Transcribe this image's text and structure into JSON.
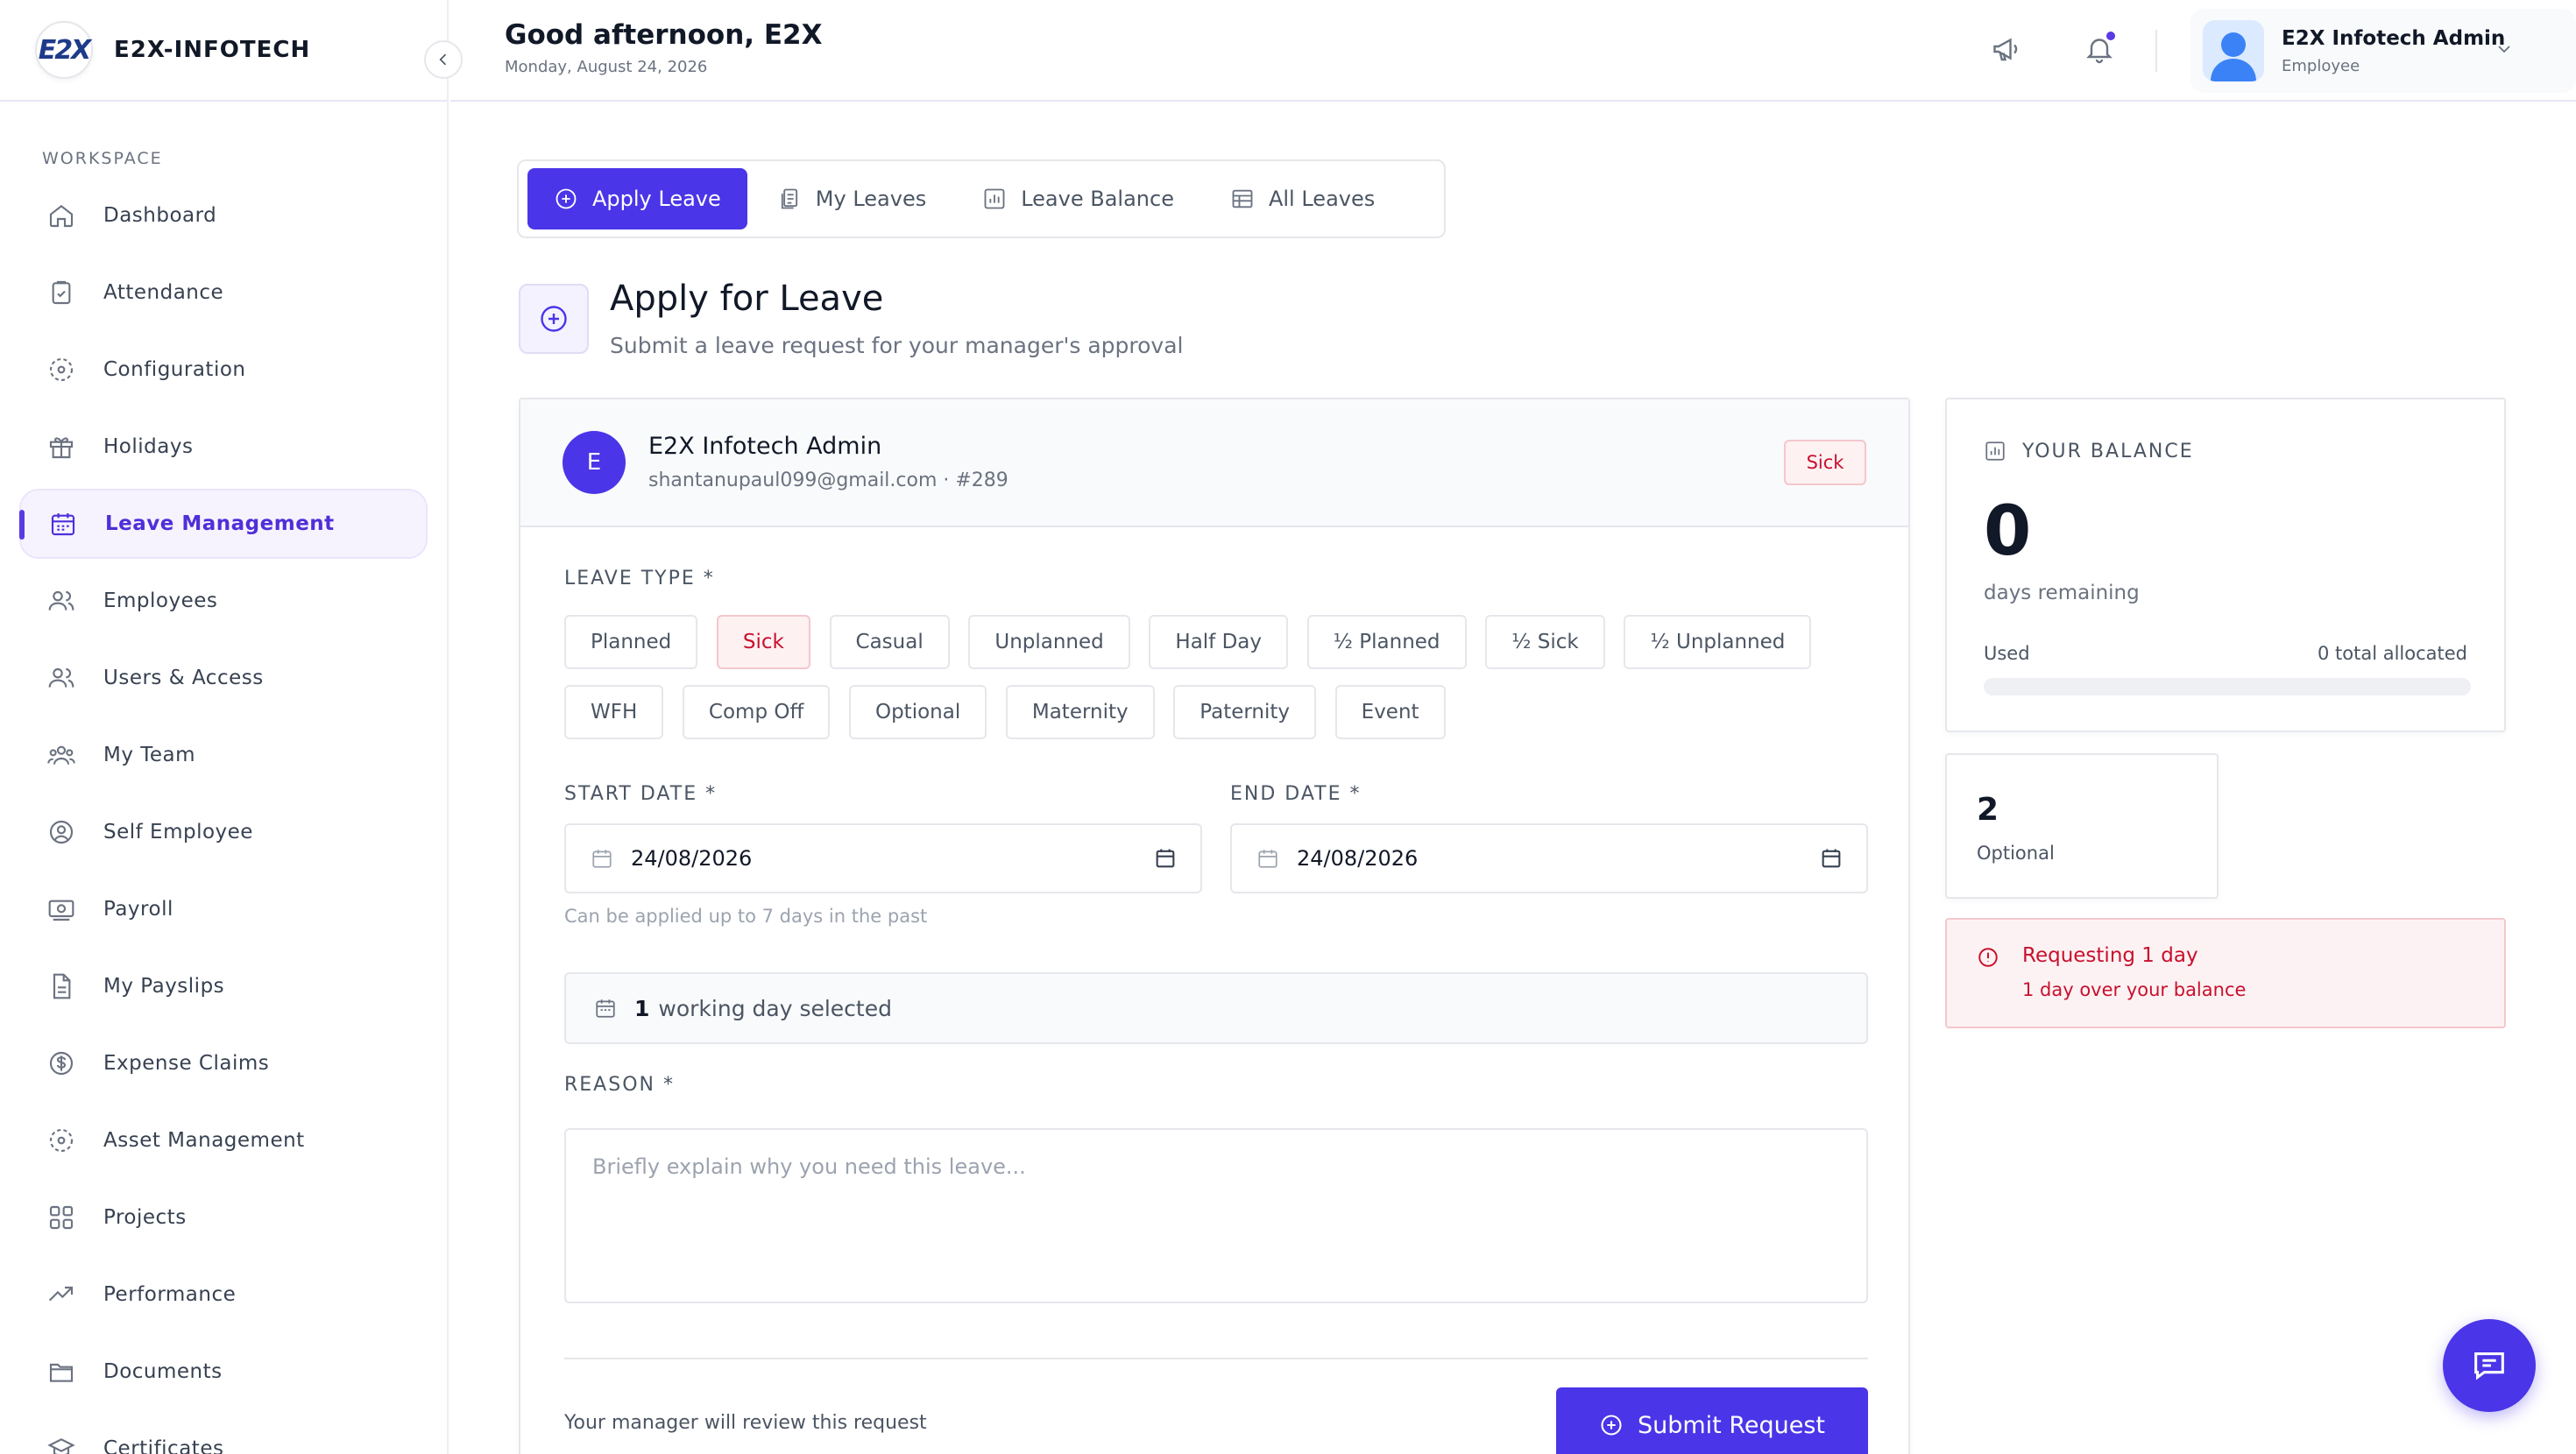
{
  "brand": {
    "logo_text": "E2X",
    "name": "E2X-INFOTECH"
  },
  "sidebar": {
    "section_label": "WORKSPACE",
    "items": [
      {
        "label": "Dashboard",
        "icon": "home-icon"
      },
      {
        "label": "Attendance",
        "icon": "clipboard-check-icon"
      },
      {
        "label": "Configuration",
        "icon": "settings-icon"
      },
      {
        "label": "Holidays",
        "icon": "gift-icon"
      },
      {
        "label": "Leave Management",
        "icon": "calendar-icon",
        "active": true
      },
      {
        "label": "Employees",
        "icon": "users-icon"
      },
      {
        "label": "Users & Access",
        "icon": "users-icon"
      },
      {
        "label": "My Team",
        "icon": "team-icon"
      },
      {
        "label": "Self Employee",
        "icon": "user-circle-icon"
      },
      {
        "label": "Payroll",
        "icon": "banknote-icon"
      },
      {
        "label": "My Payslips",
        "icon": "file-icon"
      },
      {
        "label": "Expense Claims",
        "icon": "dollar-icon"
      },
      {
        "label": "Asset Management",
        "icon": "settings-icon"
      },
      {
        "label": "Projects",
        "icon": "grid-icon"
      },
      {
        "label": "Performance",
        "icon": "trending-up-icon"
      },
      {
        "label": "Documents",
        "icon": "folder-icon"
      },
      {
        "label": "Certificates",
        "icon": "graduation-cap-icon"
      }
    ]
  },
  "header": {
    "greeting": "Good afternoon, E2X",
    "date": "Monday, August 24, 2026",
    "user_name": "E2X Infotech Admin",
    "user_role": "Employee"
  },
  "tabs": [
    {
      "label": "Apply Leave",
      "icon": "plus-circle-icon",
      "active": true
    },
    {
      "label": "My Leaves",
      "icon": "files-icon"
    },
    {
      "label": "Leave Balance",
      "icon": "chart-icon"
    },
    {
      "label": "All Leaves",
      "icon": "table-icon"
    }
  ],
  "page": {
    "title": "Apply for Leave",
    "subtitle": "Submit a leave request for your manager's approval"
  },
  "form": {
    "user_initial": "E",
    "user_name": "E2X Infotech Admin",
    "user_meta": "shantanupaul099@gmail.com · #289",
    "selected_badge": "Sick",
    "leave_type_label": "LEAVE TYPE *",
    "leave_types": [
      "Planned",
      "Sick",
      "Casual",
      "Unplanned",
      "Half Day",
      "½ Planned",
      "½ Sick",
      "½ Unplanned",
      "WFH",
      "Comp Off",
      "Optional",
      "Maternity",
      "Paternity",
      "Event"
    ],
    "selected_type": "Sick",
    "start_label": "START DATE *",
    "start_value": "24/08/2026",
    "end_label": "END DATE *",
    "end_value": "24/08/2026",
    "date_hint": "Can be applied up to 7 days in the past",
    "working_days_count": "1",
    "working_days_text": "working day selected",
    "reason_label": "REASON *",
    "reason_placeholder": "Briefly explain why you need this leave...",
    "reason_value": "",
    "footer_note": "Your manager will review this request",
    "submit_label": "Submit Request"
  },
  "balance": {
    "title": "YOUR BALANCE",
    "days_remaining": "0",
    "days_label": "days remaining",
    "used_label": "Used",
    "total_label": "0 total allocated",
    "used_fraction": 0
  },
  "optional": {
    "count": "2",
    "label": "Optional"
  },
  "warning": {
    "title": "Requesting 1 day",
    "subtitle": "1 day over your balance"
  },
  "colors": {
    "accent": "#4a35e8",
    "danger": "#c8102e",
    "danger_bg": "#fdf1f2"
  }
}
